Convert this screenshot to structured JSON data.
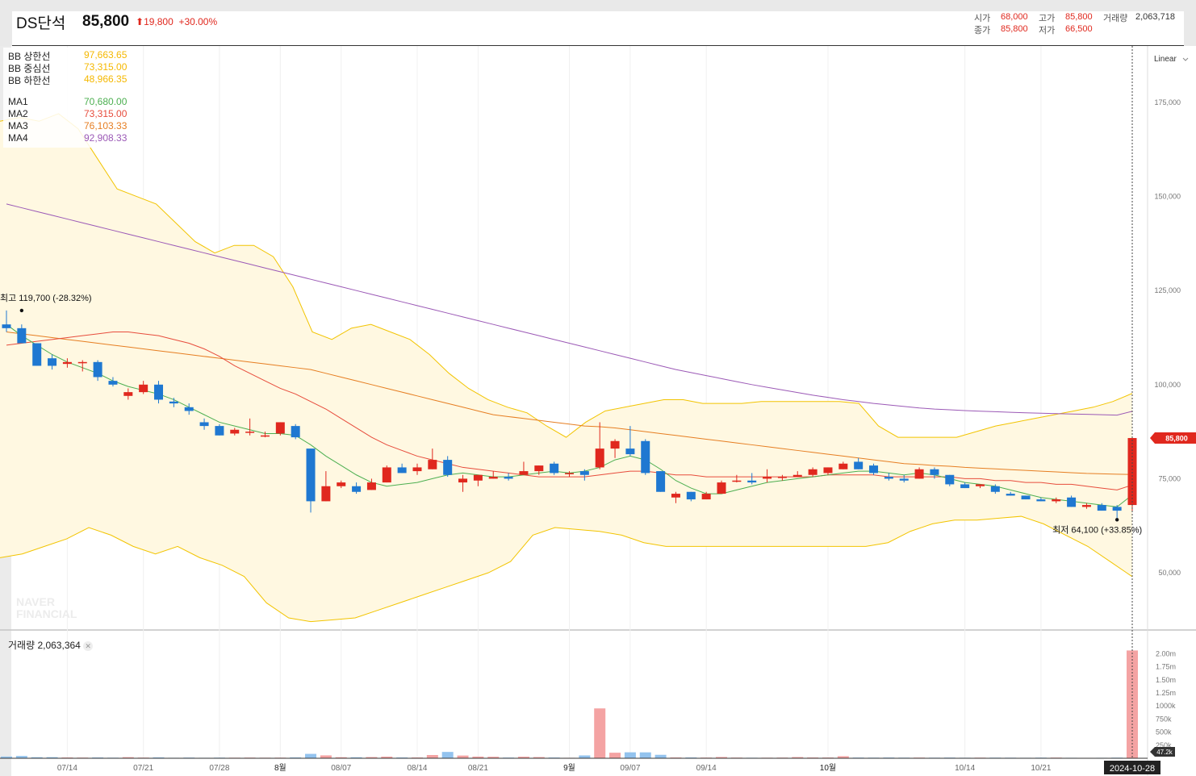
{
  "header": {
    "name": "DS단석",
    "price": "85,800",
    "change": "19,800",
    "change_pct": "+30.00%",
    "open_label": "시가",
    "open": "68,000",
    "high_label": "고가",
    "high": "85,800",
    "volume_label": "거래량",
    "volume": "2,063,718",
    "close_label": "종가",
    "close": "85,800",
    "low_label": "저가",
    "low": "66,500"
  },
  "scale_mode": "Linear",
  "legend": {
    "bb": [
      {
        "name": "BB 상한선",
        "value": "97,663.65",
        "color": "#f5b800"
      },
      {
        "name": "BB 중심선",
        "value": "73,315.00",
        "color": "#f5b800"
      },
      {
        "name": "BB 하한선",
        "value": "48,966.35",
        "color": "#f5b800"
      }
    ],
    "ma": [
      {
        "name": "MA1",
        "value": "70,680.00",
        "color": "#4caf50"
      },
      {
        "name": "MA2",
        "value": "73,315.00",
        "color": "#e74c3c"
      },
      {
        "name": "MA3",
        "value": "76,103.33",
        "color": "#e67e22"
      },
      {
        "name": "MA4",
        "value": "92,908.33",
        "color": "#9b59b6"
      }
    ]
  },
  "annotations": {
    "high": "최고 119,700 (-28.32%)",
    "low": "최저 64,100 (+33.85%)",
    "last_price_tag": "85,800",
    "last_volume_tag": "47.2k",
    "cursor_date": "2024-10-28",
    "watermark_1": "NAVER",
    "watermark_2": "FINANCIAL"
  },
  "volume_panel": {
    "label": "거래량 2,063,364"
  },
  "colors": {
    "up": "#e0281e",
    "down": "#1f78d1",
    "up_vol": "#f4a3a3",
    "down_vol": "#93c3ee",
    "bb_fill": "#fff8e1",
    "bb_line": "#f2c400"
  },
  "chart_data": {
    "type": "candlestick",
    "x_ticks": [
      "07/14",
      "07/21",
      "07/28",
      "8월",
      "08/07",
      "08/14",
      "08/21",
      "9월",
      "09/07",
      "09/14",
      "10월",
      "10/14",
      "10/21"
    ],
    "price_axis": {
      "ticks": [
        "50,000",
        "75,000",
        "100,000",
        "125,000",
        "150,000",
        "175,000"
      ],
      "ylim": [
        35000,
        190000
      ]
    },
    "volume_axis": {
      "ticks": [
        "250k",
        "500k",
        "750k",
        "1000k",
        "1.25m",
        "1.50m",
        "1.75m",
        "2.00m"
      ],
      "ylim": [
        0,
        2100000
      ]
    },
    "candles": [
      [
        116000,
        119700,
        114000,
        115000
      ],
      [
        115000,
        116000,
        111000,
        111000
      ],
      [
        111000,
        111000,
        105000,
        105000
      ],
      [
        107000,
        108000,
        104000,
        105000
      ],
      [
        105500,
        107000,
        104500,
        106000
      ],
      [
        106000,
        106500,
        103500,
        106000
      ],
      [
        106000,
        106500,
        101000,
        102000
      ],
      [
        101000,
        102000,
        99500,
        100000
      ],
      [
        97000,
        99000,
        96000,
        98000
      ],
      [
        98000,
        101000,
        97500,
        100000
      ],
      [
        100000,
        101000,
        95000,
        96000
      ],
      [
        95500,
        96500,
        94000,
        95000
      ],
      [
        94000,
        95000,
        92000,
        93000
      ],
      [
        90000,
        91000,
        88000,
        89000
      ],
      [
        89000,
        89500,
        86500,
        86500
      ],
      [
        87000,
        88500,
        86500,
        88000
      ],
      [
        87500,
        91000,
        86500,
        87500
      ],
      [
        86500,
        87500,
        86000,
        86500
      ],
      [
        87000,
        90000,
        86500,
        90000
      ],
      [
        89000,
        89500,
        85500,
        86000
      ],
      [
        83000,
        83000,
        66000,
        69000
      ],
      [
        69000,
        77000,
        69000,
        73000
      ],
      [
        73000,
        74500,
        72500,
        74000
      ],
      [
        73000,
        74000,
        71000,
        71500
      ],
      [
        72000,
        75000,
        72000,
        74000
      ],
      [
        74000,
        78500,
        74000,
        78000
      ],
      [
        78000,
        79000,
        76500,
        76500
      ],
      [
        77000,
        79000,
        76000,
        78000
      ],
      [
        77500,
        83000,
        77500,
        80000
      ],
      [
        80000,
        81000,
        75500,
        76000
      ],
      [
        74000,
        76000,
        71500,
        75000
      ],
      [
        74500,
        76000,
        73000,
        76000
      ],
      [
        75000,
        77000,
        75000,
        75500
      ],
      [
        75500,
        76500,
        74500,
        75000
      ],
      [
        76000,
        79500,
        76000,
        77000
      ],
      [
        77000,
        78500,
        76000,
        78500
      ],
      [
        79000,
        79500,
        76000,
        76500
      ],
      [
        76500,
        77000,
        75500,
        76500
      ],
      [
        77000,
        77500,
        74500,
        76000
      ],
      [
        78000,
        90000,
        77500,
        83000
      ],
      [
        83000,
        85500,
        80500,
        85000
      ],
      [
        83000,
        89000,
        81000,
        81500
      ],
      [
        85000,
        85500,
        76000,
        76500
      ],
      [
        77000,
        77000,
        71500,
        71500
      ],
      [
        70000,
        71500,
        68500,
        71000
      ],
      [
        71500,
        71500,
        69000,
        69500
      ],
      [
        69500,
        71500,
        69500,
        71000
      ],
      [
        71000,
        74500,
        71000,
        74000
      ],
      [
        74500,
        76000,
        74000,
        74500
      ],
      [
        74500,
        76500,
        73500,
        74000
      ],
      [
        75000,
        77500,
        74000,
        75500
      ],
      [
        75500,
        76000,
        74500,
        75500
      ],
      [
        75500,
        77000,
        75500,
        76000
      ],
      [
        76000,
        78000,
        75500,
        77500
      ],
      [
        76500,
        78000,
        76000,
        78000
      ],
      [
        77500,
        79500,
        77500,
        79000
      ],
      [
        79500,
        80500,
        77500,
        77500
      ],
      [
        78500,
        79000,
        76000,
        76500
      ],
      [
        75500,
        76500,
        74500,
        75000
      ],
      [
        75000,
        76000,
        74000,
        74500
      ],
      [
        75000,
        78000,
        75000,
        77500
      ],
      [
        77500,
        78000,
        75000,
        76000
      ],
      [
        76000,
        76000,
        73000,
        73500
      ],
      [
        73500,
        74000,
        72500,
        72500
      ],
      [
        73000,
        73500,
        72500,
        73500
      ],
      [
        73000,
        73500,
        71000,
        71500
      ],
      [
        71000,
        71500,
        70500,
        70500
      ],
      [
        70500,
        70500,
        69500,
        69500
      ],
      [
        69500,
        70000,
        69000,
        69000
      ],
      [
        69000,
        70000,
        68500,
        69500
      ],
      [
        70000,
        70500,
        67500,
        67500
      ],
      [
        67500,
        68500,
        67000,
        68000
      ],
      [
        68000,
        68500,
        66500,
        66500
      ],
      [
        67500,
        68000,
        64100,
        66500
      ],
      [
        68000,
        85800,
        66500,
        85800
      ]
    ],
    "volume": [
      33000,
      44000,
      20000,
      21000,
      15000,
      13000,
      15000,
      11000,
      21000,
      13000,
      17000,
      9000,
      13000,
      9000,
      12000,
      11000,
      13000,
      11000,
      12000,
      16000,
      84000,
      55000,
      20000,
      19000,
      23000,
      31000,
      15000,
      15000,
      62000,
      121000,
      52000,
      32000,
      29000,
      13000,
      30000,
      23000,
      14000,
      9000,
      54000,
      954000,
      106000,
      114000,
      113000,
      66000,
      15000,
      15000,
      13000,
      24000,
      13000,
      10000,
      11000,
      13000,
      23000,
      15000,
      14000,
      39000,
      13000,
      12000,
      14000,
      12000,
      13000,
      11000,
      13000,
      10000,
      12000,
      12000,
      11000,
      9000,
      12000,
      13000,
      9000,
      8000,
      9000,
      12000,
      2063364
    ],
    "ma1": [
      116000,
      113000,
      110500,
      108000,
      106000,
      104500,
      103000,
      101000,
      99500,
      98500,
      97500,
      96000,
      94000,
      92000,
      90000,
      89000,
      88000,
      87000,
      87000,
      86500,
      84000,
      81000,
      78500,
      76000,
      74000,
      73000,
      73500,
      74000,
      75000,
      76000,
      76500,
      76000,
      75500,
      75500,
      76000,
      76500,
      77000,
      76500,
      77000,
      78000,
      80000,
      81000,
      80000,
      77500,
      74500,
      72500,
      71000,
      71000,
      72000,
      73000,
      74000,
      74500,
      75000,
      75500,
      76000,
      76500,
      77000,
      77000,
      76500,
      76000,
      76500,
      76000,
      75000,
      74000,
      73500,
      73000,
      72000,
      71000,
      70000,
      69500,
      69000,
      68500,
      68000,
      67500,
      70680
    ],
    "ma2": [
      110500,
      111000,
      111500,
      112000,
      112500,
      113000,
      113500,
      114000,
      114000,
      113500,
      113000,
      112000,
      111000,
      109500,
      107500,
      105000,
      103000,
      101000,
      99000,
      97500,
      95500,
      93500,
      91000,
      88500,
      86000,
      84000,
      82500,
      81000,
      80000,
      79000,
      78000,
      77500,
      77000,
      76500,
      76000,
      75500,
      75500,
      75500,
      75500,
      76000,
      76500,
      77000,
      77000,
      76500,
      76000,
      76000,
      75500,
      75500,
      75500,
      75500,
      75500,
      75500,
      75500,
      75500,
      76000,
      76000,
      76000,
      76000,
      75500,
      75500,
      75500,
      75500,
      75500,
      75000,
      75000,
      74500,
      74500,
      74000,
      74000,
      73500,
      73500,
      73000,
      72500,
      72000,
      73315
    ],
    "ma3": [
      114000,
      113500,
      113000,
      112500,
      112000,
      111500,
      111000,
      110500,
      110000,
      109500,
      109000,
      108500,
      108000,
      107500,
      107000,
      106500,
      106000,
      105500,
      105000,
      104500,
      104000,
      103000,
      102000,
      101000,
      100000,
      99000,
      98000,
      97000,
      96000,
      95000,
      94000,
      93000,
      92000,
      91500,
      91000,
      90500,
      90000,
      89500,
      89000,
      88800,
      88500,
      88000,
      87500,
      87000,
      86500,
      86000,
      85500,
      85000,
      84500,
      84000,
      83500,
      83000,
      82500,
      82000,
      81500,
      81000,
      80500,
      80000,
      79500,
      79000,
      78800,
      78500,
      78300,
      78000,
      77800,
      77600,
      77400,
      77200,
      77000,
      76800,
      76600,
      76400,
      76300,
      76200,
      76103
    ],
    "ma4": [
      148000,
      147000,
      146000,
      145000,
      144000,
      143000,
      142000,
      141000,
      140000,
      139000,
      138000,
      137000,
      136000,
      135000,
      134000,
      133000,
      132000,
      131000,
      130000,
      129000,
      128000,
      127000,
      126000,
      125000,
      124000,
      123000,
      122000,
      121000,
      120000,
      119000,
      118000,
      117000,
      116000,
      115000,
      114000,
      113000,
      112000,
      111000,
      110000,
      109000,
      108000,
      107000,
      106000,
      105000,
      104000,
      103200,
      102400,
      101600,
      100800,
      100000,
      99300,
      98600,
      97900,
      97200,
      96600,
      96000,
      95500,
      95000,
      94600,
      94200,
      93800,
      93500,
      93300,
      93100,
      92950,
      92800,
      92650,
      92500,
      92400,
      92300,
      92200,
      92100,
      92000,
      91900,
      92908
    ],
    "bb_upper": [
      170000,
      171000,
      170000,
      172000,
      168000,
      160000,
      152000,
      150000,
      148000,
      143000,
      138000,
      135000,
      137000,
      137000,
      134000,
      126000,
      114000,
      112000,
      115000,
      116000,
      114000,
      112000,
      108000,
      103000,
      99000,
      96000,
      94000,
      92500,
      89000,
      86000,
      90000,
      93000,
      94000,
      95000,
      96000,
      96000,
      95000,
      95000,
      95000,
      95500,
      95500,
      95500,
      95500,
      95500,
      95000,
      89000,
      86000,
      86000,
      86000,
      86000,
      87500,
      89000,
      90000,
      91000,
      92000,
      93000,
      94000,
      95500,
      97663
    ],
    "bb_lower": [
      54000,
      55000,
      57000,
      59000,
      62000,
      60000,
      57000,
      55000,
      57000,
      54000,
      52000,
      49000,
      42000,
      38000,
      37000,
      37500,
      38000,
      40000,
      42000,
      44000,
      46000,
      48000,
      50000,
      53000,
      60000,
      62000,
      61500,
      61000,
      60000,
      58000,
      57000,
      57000,
      57000,
      57000,
      57000,
      57000,
      57000,
      57000,
      57000,
      57000,
      58000,
      61000,
      63000,
      64000,
      64000,
      64500,
      65000,
      63000,
      60000,
      57000,
      53000,
      48966
    ],
    "bb_mid": [
      110500,
      111000,
      111500,
      112000,
      112500,
      113000,
      113500,
      114000,
      114000,
      113500,
      113000,
      112000,
      111000,
      109500,
      107500,
      105000,
      103000,
      101000,
      99000,
      97500,
      95500,
      93500,
      91000,
      88500,
      86000,
      84000,
      82500,
      81000,
      80000,
      79000,
      78000,
      77500,
      77000,
      76500,
      76000,
      75500,
      75500,
      75500,
      75500,
      76000,
      76500,
      77000,
      77000,
      76500,
      76000,
      76000,
      75500,
      75500,
      75500,
      75500,
      75500,
      75500,
      75500,
      75500,
      76000,
      76000,
      76000,
      76000,
      75500,
      75500,
      75500,
      75500,
      75500,
      75000,
      75000,
      74500,
      74500,
      74000,
      74000,
      73500,
      73500,
      73000,
      72500,
      72000,
      73315
    ]
  }
}
